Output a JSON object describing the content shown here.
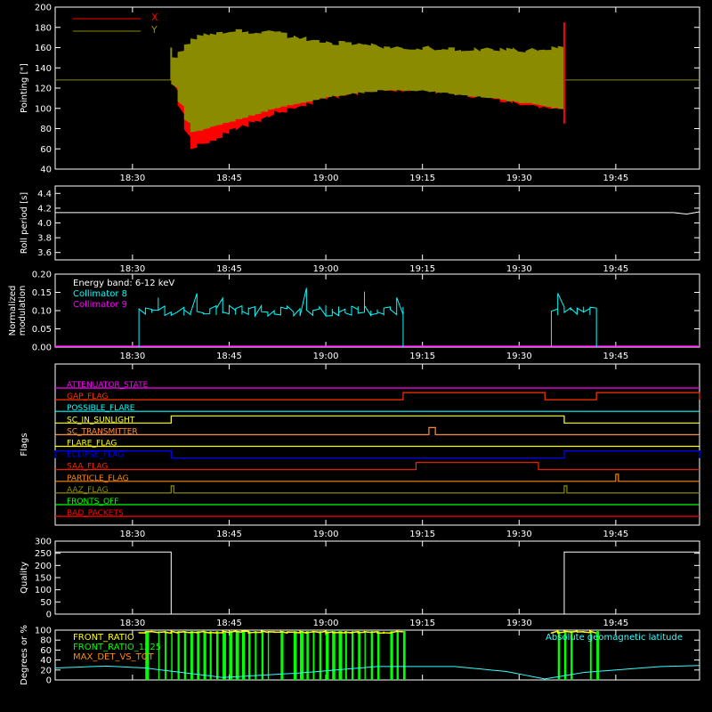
{
  "chart_data": [
    {
      "type": "line",
      "ylabel": "Pointing [\"]",
      "ylim": [
        40,
        200
      ],
      "yticks": [
        40,
        60,
        80,
        100,
        120,
        140,
        160,
        180,
        200
      ],
      "xticks": [
        "18:30",
        "18:45",
        "19:00",
        "19:15",
        "19:30",
        "19:45"
      ],
      "legend": [
        {
          "label": "X",
          "color": "#ff0000"
        },
        {
          "label": "Y",
          "color": "#8b8b00"
        }
      ],
      "series": [
        {
          "name": "X",
          "color": "#ff0000",
          "x": [
            "18:36",
            "18:39",
            "18:45",
            "18:52",
            "19:00",
            "19:08",
            "19:15",
            "19:22",
            "19:30",
            "19:37"
          ],
          "mean": [
            128,
            87,
            93,
            103,
            112,
            117,
            117,
            113,
            107,
            100
          ],
          "low": [
            128,
            57,
            75,
            92,
            108,
            116,
            116,
            110,
            103,
            95
          ]
        },
        {
          "name": "Y",
          "color": "#8b8b00",
          "x": [
            "18:36",
            "18:39",
            "18:45",
            "18:52",
            "19:00",
            "19:08",
            "19:15",
            "19:22",
            "19:30",
            "19:37"
          ],
          "high": [
            150,
            172,
            179,
            177,
            168,
            164,
            162,
            161,
            160,
            163
          ]
        }
      ],
      "baseline": 128
    },
    {
      "type": "line",
      "ylabel": "Roll period [s]",
      "ylim": [
        3.5,
        4.5
      ],
      "yticks": [
        "3.6",
        "3.8",
        "4.0",
        "4.2",
        "4.4"
      ],
      "xticks": [
        "18:30",
        "18:45",
        "19:00",
        "19:15",
        "19:30",
        "19:45"
      ],
      "series": [
        {
          "x": [
            "18:18",
            "19:54",
            "19:56",
            "19:58"
          ],
          "values": [
            4.14,
            4.14,
            4.12,
            4.15
          ]
        }
      ]
    },
    {
      "type": "line",
      "ylabel": "Normalized modulation",
      "ylabel_lines": [
        "Normalized",
        "modulation"
      ],
      "ylim": [
        0,
        0.2
      ],
      "yticks": [
        "0.00",
        "0.05",
        "0.10",
        "0.15",
        "0.20"
      ],
      "xticks": [
        "18:30",
        "18:45",
        "19:00",
        "19:15",
        "19:30",
        "19:45"
      ],
      "legend": [
        {
          "label": "Energy band: 6-12 keV",
          "color": "#ffffff"
        },
        {
          "label": "Collimator 8",
          "color": "#00ffff"
        },
        {
          "label": "Collimator 9",
          "color": "#ff00ff"
        }
      ],
      "series": [
        {
          "name": "Collimator 8",
          "color": "#00ffff",
          "segments": [
            {
              "start": "18:31",
              "end": "19:12",
              "level": 0.1
            },
            {
              "start": "19:35",
              "end": "19:42",
              "level": 0.1
            }
          ]
        },
        {
          "name": "Collimator 9",
          "color": "#ff00ff",
          "segments": [
            {
              "start": "18:18",
              "end": "19:58",
              "level": 0.0
            }
          ]
        }
      ]
    },
    {
      "type": "line",
      "ylabel": "Flags",
      "xticks": [
        "18:30",
        "18:45",
        "19:00",
        "19:15",
        "19:30",
        "19:45"
      ],
      "flags": [
        {
          "name": "ATTENUATOR_STATE",
          "color": "#ff00ff",
          "high": []
        },
        {
          "name": "GAP_FLAG",
          "color": "#ff3300",
          "high": [
            [
              "19:12",
              "19:34"
            ],
            [
              "19:42",
              "19:58"
            ]
          ]
        },
        {
          "name": "POSSIBLE_FLARE",
          "color": "#00ffff",
          "high": []
        },
        {
          "name": "SC_IN_SUNLIGHT",
          "color": "#ffff33",
          "high": [
            [
              "18:36",
              "19:37"
            ]
          ]
        },
        {
          "name": "SC_TRANSMITTER",
          "color": "#ff8c33",
          "high": [
            [
              "19:16",
              "19:17"
            ]
          ]
        },
        {
          "name": "FLARE_FLAG",
          "color": "#ffff00",
          "high": []
        },
        {
          "name": "ECLIPSE_FLAG",
          "color": "#0000ff",
          "high": [
            [
              "18:18",
              "18:36"
            ],
            [
              "19:37",
              "19:58"
            ]
          ]
        },
        {
          "name": "SAA_FLAG",
          "color": "#ff2200",
          "high": [
            [
              "19:14",
              "19:33"
            ]
          ]
        },
        {
          "name": "PARTICLE_FLAG",
          "color": "#ff8800",
          "high": [
            [
              "19:45",
              "19:45"
            ]
          ]
        },
        {
          "name": "AAZ_FLAG",
          "color": "#8b8b00",
          "high": [
            [
              "18:36",
              "18:36"
            ],
            [
              "19:37",
              "19:37"
            ]
          ]
        },
        {
          "name": "FRONTS_OFF",
          "color": "#00ff00",
          "high": []
        },
        {
          "name": "BAD_PACKETS",
          "color": "#ff0000",
          "high": []
        }
      ]
    },
    {
      "type": "line",
      "ylabel": "Quality",
      "ylim": [
        0,
        300
      ],
      "yticks": [
        0,
        50,
        100,
        150,
        200,
        250,
        300
      ],
      "xticks": [
        "18:30",
        "18:45",
        "19:00",
        "19:15",
        "19:30",
        "19:45"
      ],
      "series": [
        {
          "x": [
            "18:18",
            "18:36",
            "18:36",
            "19:37",
            "19:37",
            "19:58"
          ],
          "values": [
            255,
            255,
            0,
            0,
            255,
            255
          ]
        }
      ]
    },
    {
      "type": "bar",
      "ylabel": "Degrees or %",
      "ylim": [
        0,
        100
      ],
      "yticks": [
        0,
        20,
        40,
        60,
        80,
        100
      ],
      "xticks": [
        "18:30",
        "18:45",
        "19:00",
        "19:15",
        "19:30",
        "19:45"
      ],
      "legend": [
        {
          "label": "FRONT_RATIO",
          "color": "#ffff00"
        },
        {
          "label": "FRONT_RATIO_1225",
          "color": "#00ff00"
        },
        {
          "label": "MAX_DET_VS_TOT",
          "color": "#ff8c00"
        },
        {
          "label": "Absolute geomagnetic latitude",
          "color": "#33ffff"
        }
      ],
      "series": [
        {
          "name": "FRONT_RATIO_1225",
          "color": "#00ff00",
          "segments": [
            {
              "start": "18:31",
              "end": "19:12"
            },
            {
              "start": "19:35",
              "end": "19:42"
            }
          ]
        },
        {
          "name": "FRONT_RATIO",
          "color": "#ffff00",
          "segments": [
            {
              "start": "18:31",
              "end": "19:12"
            },
            {
              "start": "19:35",
              "end": "19:42"
            }
          ],
          "level": 98
        },
        {
          "name": "Absolute geomagnetic latitude",
          "color": "#33ffff",
          "x": [
            "18:18",
            "18:26",
            "18:32",
            "18:44",
            "18:56",
            "19:08",
            "19:20",
            "19:28",
            "19:34",
            "19:40",
            "19:52",
            "19:58"
          ],
          "values": [
            24,
            28,
            24,
            5,
            14,
            27,
            27,
            17,
            2,
            15,
            27,
            29
          ]
        }
      ]
    }
  ]
}
